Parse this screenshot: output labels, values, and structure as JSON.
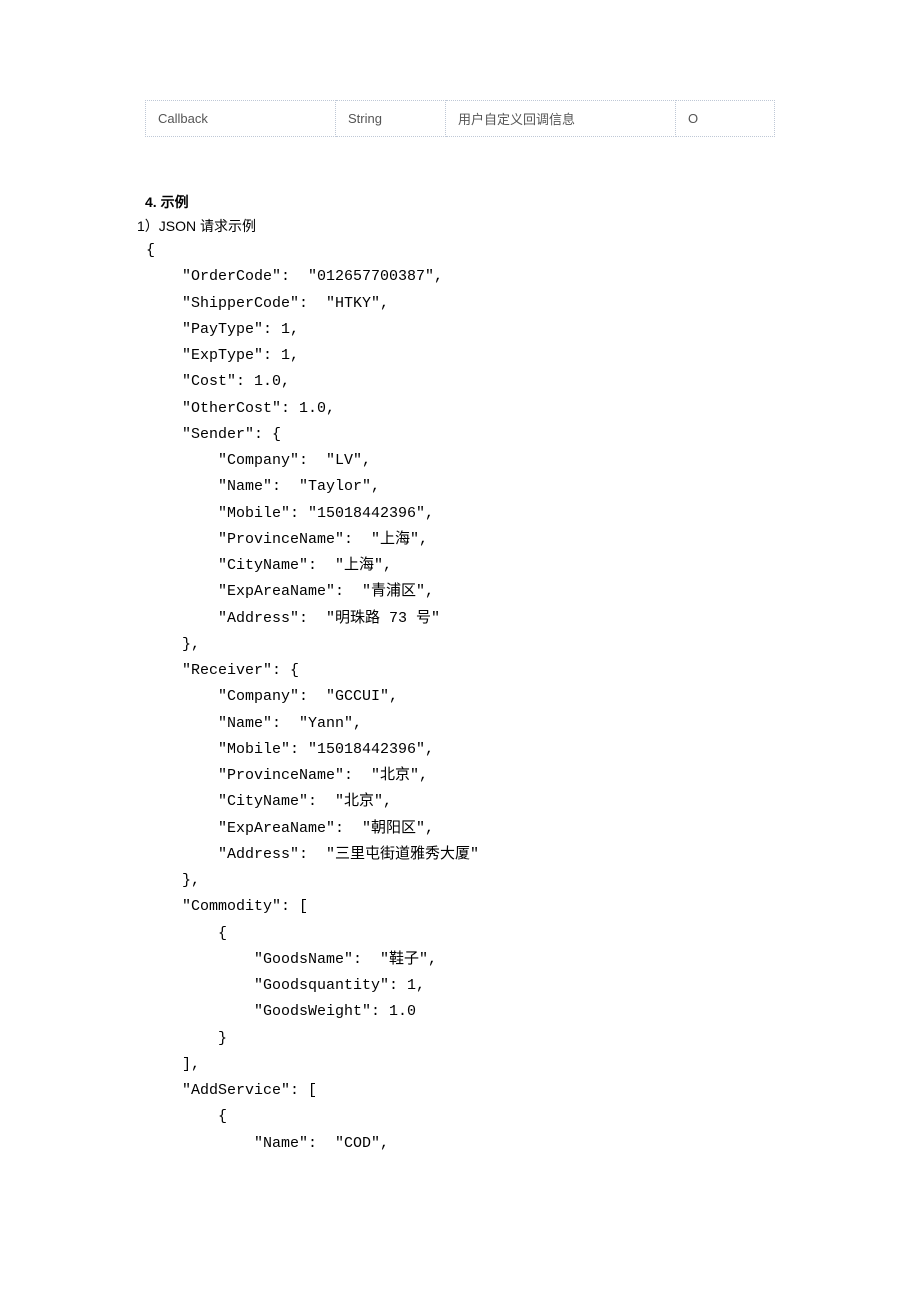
{
  "table": {
    "row": {
      "param": "Callback",
      "type": "String",
      "desc": "用户自定义回调信息",
      "required": "O"
    }
  },
  "section": {
    "title": "4.  示例",
    "subtitle": "1）JSON 请求示例"
  },
  "code": " {\n     \"OrderCode\":  \"012657700387\",\n     \"ShipperCode\":  \"HTKY\",\n     \"PayType\": 1,\n     \"ExpType\": 1,\n     \"Cost\": 1.0,\n     \"OtherCost\": 1.0,\n     \"Sender\": {\n         \"Company\":  \"LV\",\n         \"Name\":  \"Taylor\",\n         \"Mobile\": \"15018442396\",\n         \"ProvinceName\":  \"上海\",\n         \"CityName\":  \"上海\",\n         \"ExpAreaName\":  \"青浦区\",\n         \"Address\":  \"明珠路 73 号\"\n     },\n     \"Receiver\": {\n         \"Company\":  \"GCCUI\",\n         \"Name\":  \"Yann\",\n         \"Mobile\": \"15018442396\",\n         \"ProvinceName\":  \"北京\",\n         \"CityName\":  \"北京\",\n         \"ExpAreaName\":  \"朝阳区\",\n         \"Address\":  \"三里屯街道雅秀大厦\"\n     },\n     \"Commodity\": [\n         {\n             \"GoodsName\":  \"鞋子\",\n             \"Goodsquantity\": 1,\n             \"GoodsWeight\": 1.0\n         }\n     ],\n     \"AddService\": [\n         {\n             \"Name\":  \"COD\","
}
